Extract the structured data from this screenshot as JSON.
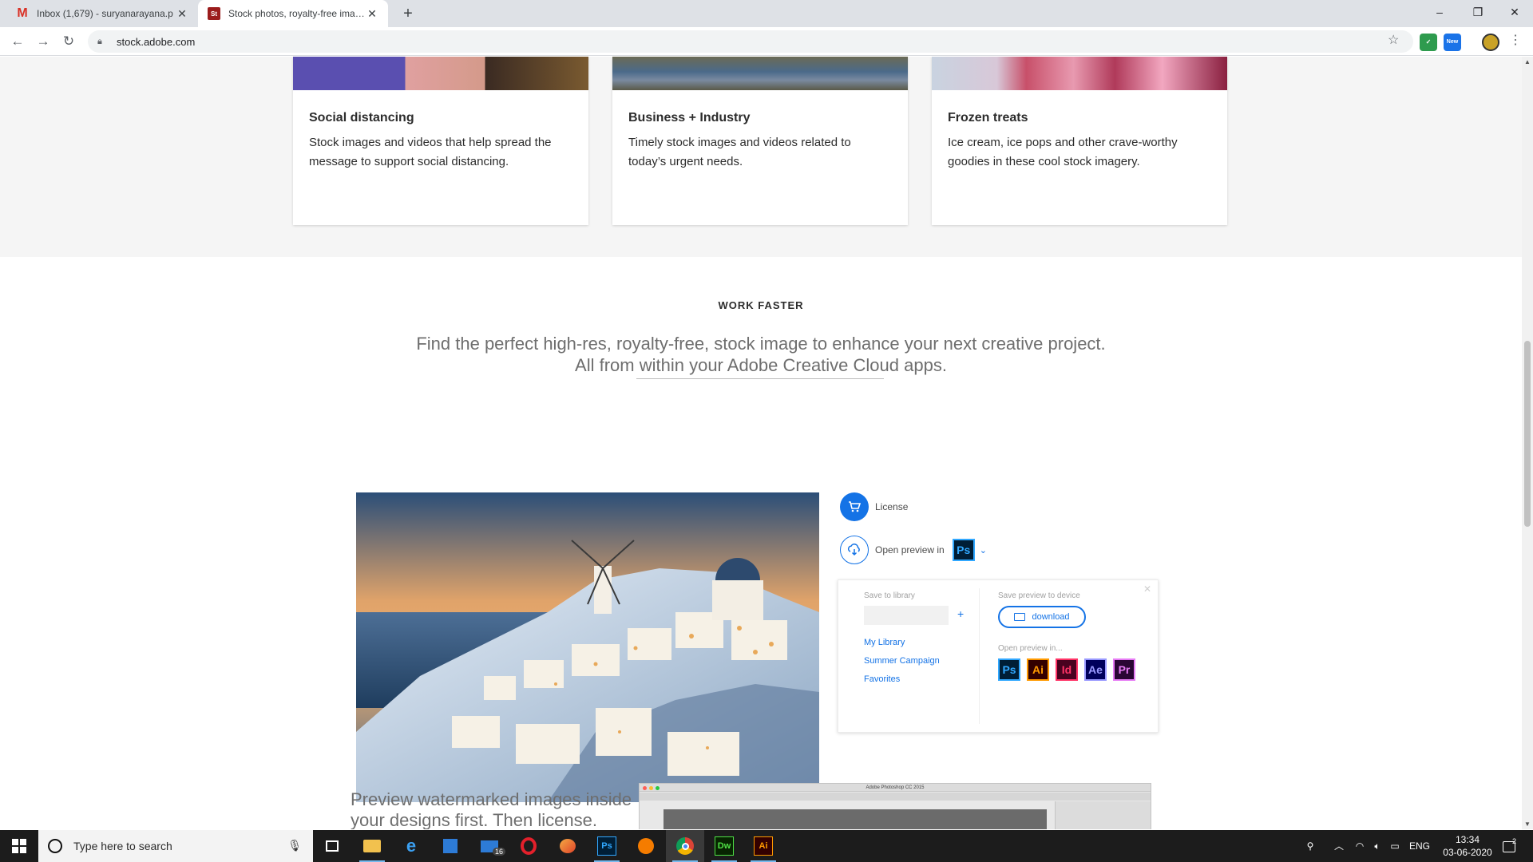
{
  "browser": {
    "tabs": [
      {
        "title": "Inbox (1,679) - suryanarayana.p",
        "favicon": "gmail-icon",
        "active": false
      },
      {
        "title": "Stock photos, royalty-free image",
        "favicon": "adobe-stock-icon",
        "active": true
      }
    ],
    "new_tab": "+",
    "url": "stock.adobe.com",
    "window_controls": {
      "minimize": "–",
      "restore": "❐",
      "close": "✕"
    },
    "extension_badge": "New"
  },
  "cards": [
    {
      "title": "Social distancing",
      "description": "Stock images and videos that help spread the message to support social distancing."
    },
    {
      "title": "Business + Industry",
      "description": "Timely stock images and videos related to today’s urgent needs."
    },
    {
      "title": "Frozen treats",
      "description": "Ice cream, ice pops and other crave-worthy goodies in these cool stock imagery."
    }
  ],
  "work_faster": {
    "label": "WORK FASTER",
    "copy_line1": "Find the perfect high-res, royalty-free, stock image to enhance your next creative project.",
    "copy_line2": "All from within your Adobe Creative Cloud apps."
  },
  "actions": {
    "license_label": "License",
    "open_preview_label": "Open preview in",
    "selected_app": "Ps"
  },
  "popup": {
    "save_to_library": "Save to library",
    "save_preview": "Save preview to device",
    "download_label": "download",
    "open_preview_in": "Open preview in...",
    "libraries": [
      "My Library",
      "Summer Campaign",
      "Favorites"
    ],
    "apps": [
      "Ps",
      "Ai",
      "Id",
      "Ae",
      "Pr"
    ]
  },
  "preview": {
    "line1": "Preview watermarked images inside",
    "line2": "your designs first. Then license.",
    "ps_window_title": "Adobe Photoshop CC 2015"
  },
  "taskbar": {
    "search_placeholder": "Type here to search",
    "mail_badge": "16",
    "language": "ENG",
    "time": "13:34",
    "date": "03-06-2020",
    "notification_count": "2",
    "pinned": [
      "task-view",
      "file-explorer",
      "edge",
      "store",
      "mail",
      "opera",
      "paint",
      "photoshop",
      "avast",
      "chrome",
      "dreamweaver",
      "illustrator"
    ]
  },
  "colors": {
    "accent_blue": "#1473e6",
    "tab_strip": "#dee1e6",
    "taskbar": "#1c1c1c"
  }
}
